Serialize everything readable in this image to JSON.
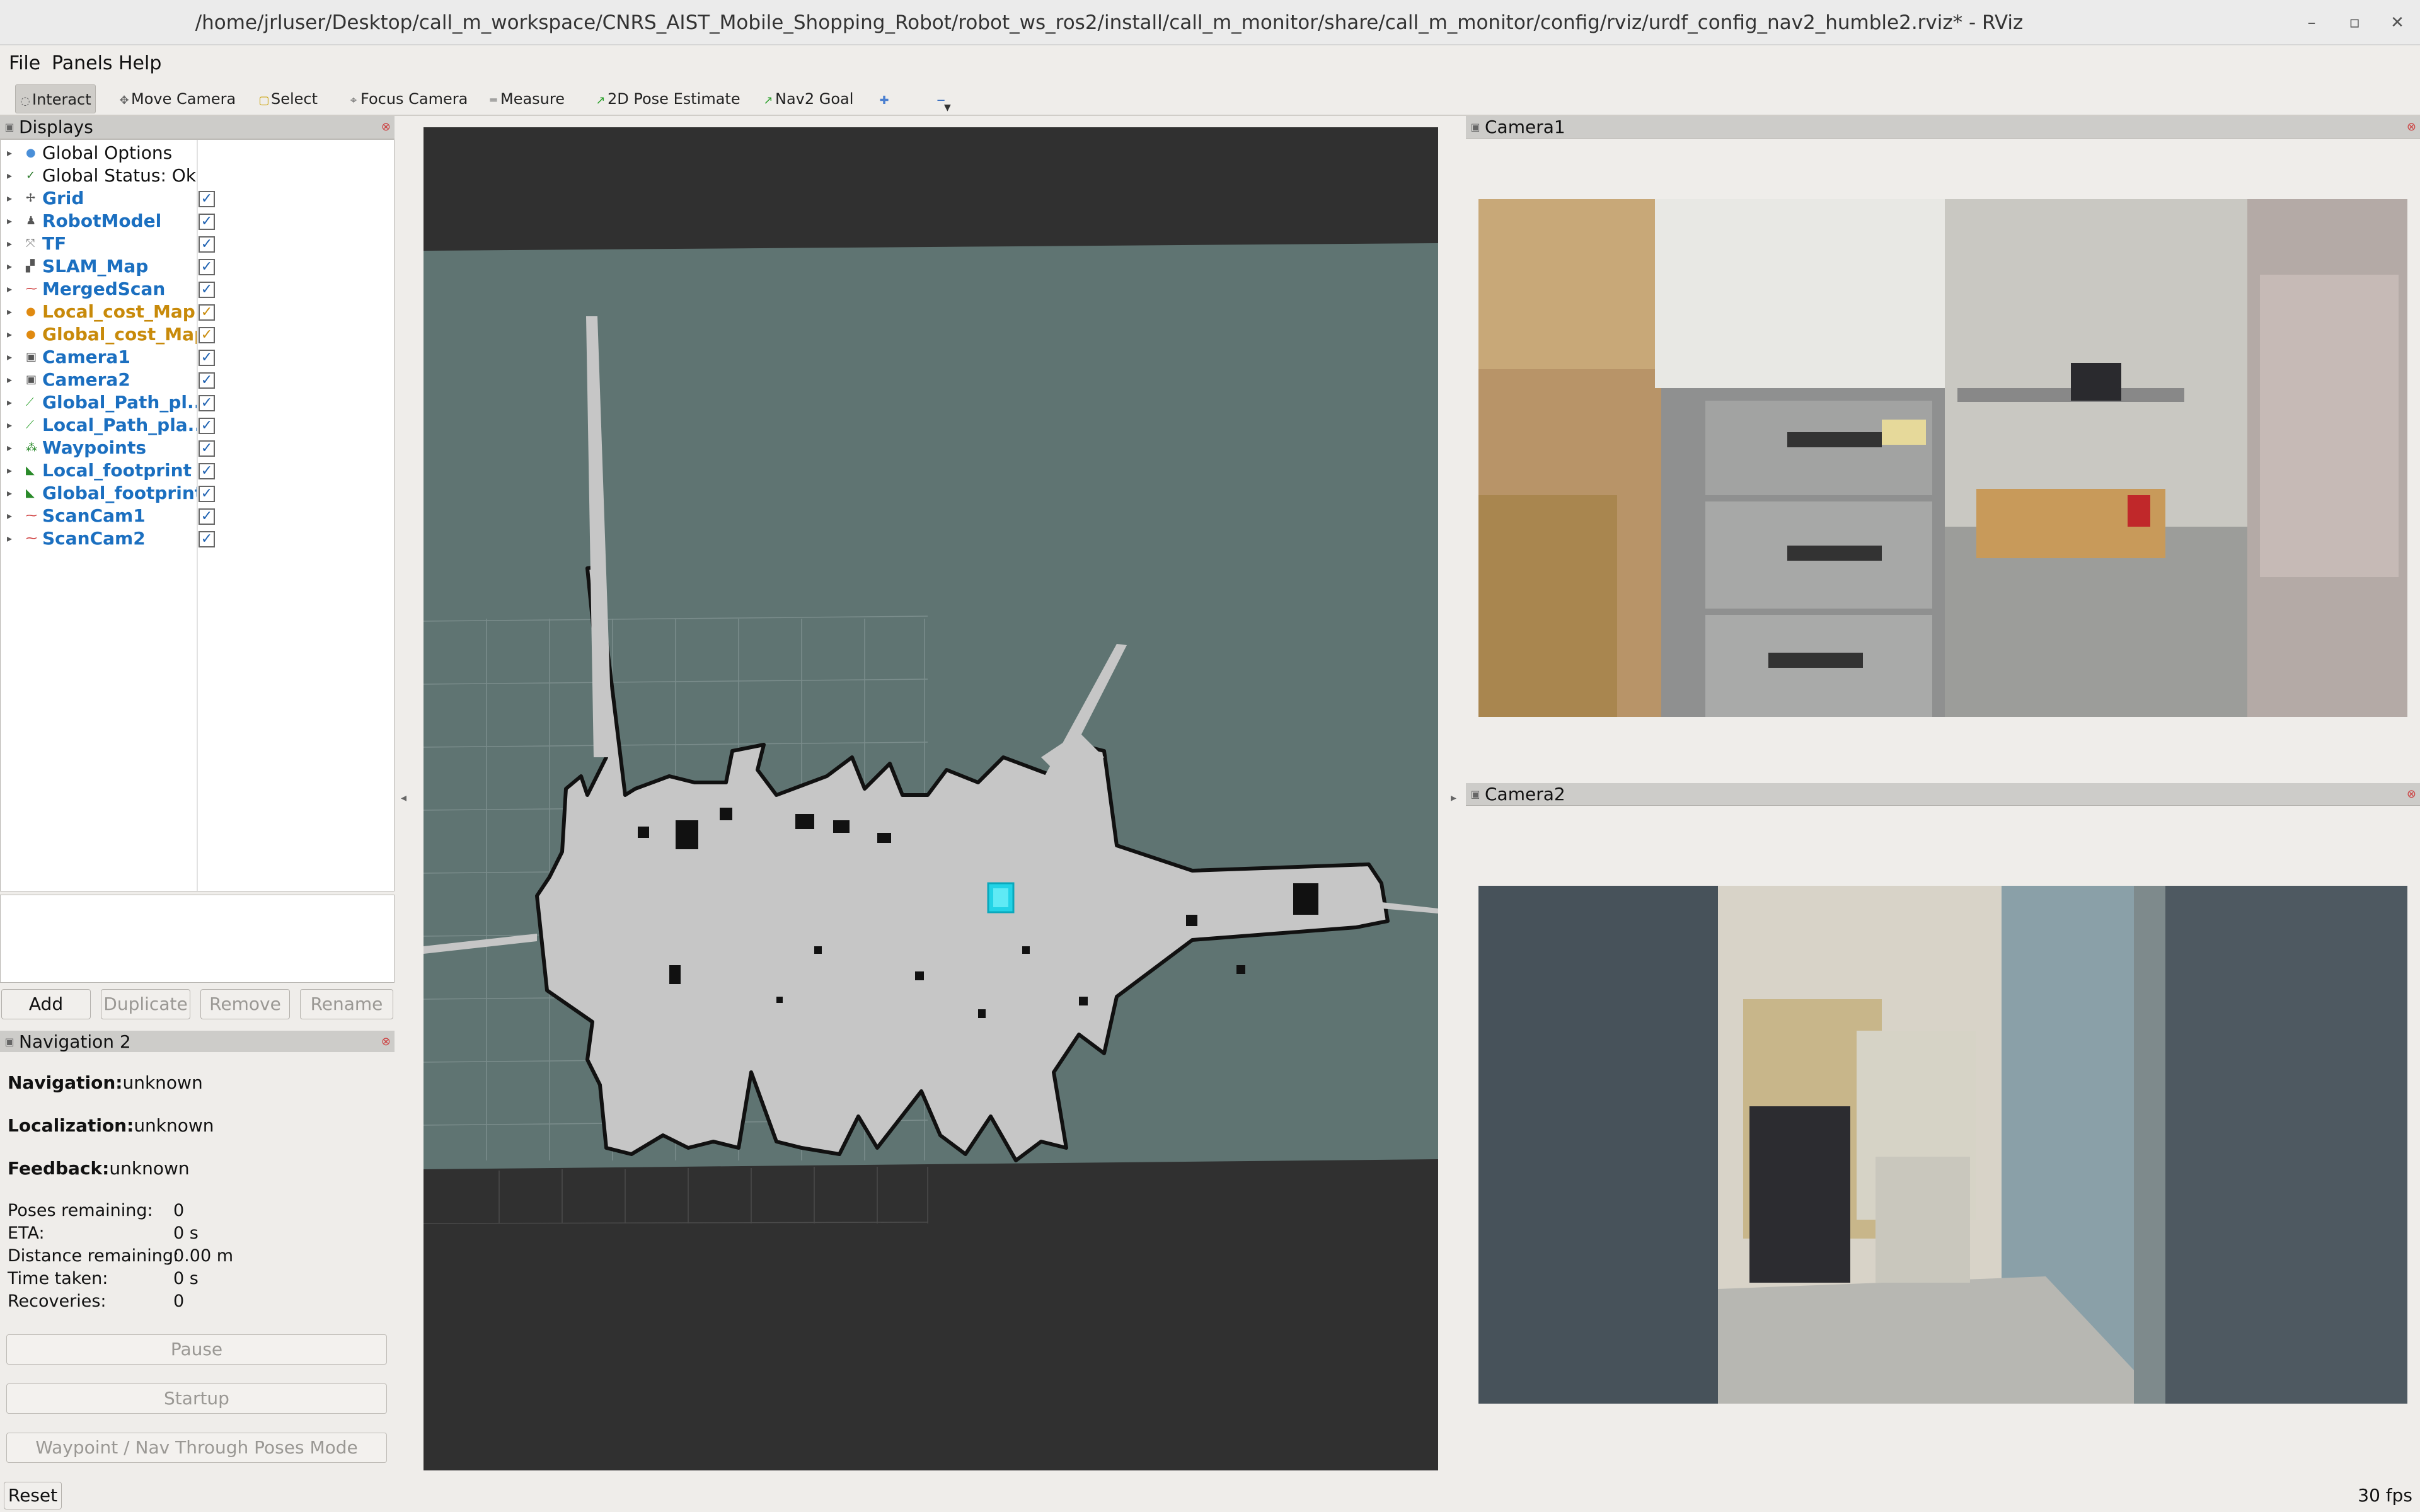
{
  "window": {
    "title": "/home/jrluser/Desktop/call_m_workspace/CNRS_AIST_Mobile_Shopping_Robot/robot_ws_ros2/install/call_m_monitor/share/call_m_monitor/config/rviz/urdf_config_nav2_humble2.rviz* - RViz",
    "controls": [
      "–",
      "▫",
      "✕"
    ]
  },
  "menu": [
    {
      "label": "File"
    },
    {
      "label": "Panels"
    },
    {
      "label": "Help"
    }
  ],
  "toolbar": [
    {
      "label": "Interact",
      "icon": "interact-icon",
      "glyph": "◌"
    },
    {
      "label": "Move Camera",
      "icon": "move-camera-icon",
      "glyph": "✥"
    },
    {
      "label": "Select",
      "icon": "select-icon",
      "glyph": "▢"
    },
    {
      "label": "Focus Camera",
      "icon": "focus-camera-icon",
      "glyph": "⌖"
    },
    {
      "label": "Measure",
      "icon": "measure-icon",
      "glyph": "═"
    },
    {
      "label": "2D Pose Estimate",
      "icon": "pose-estimate-icon",
      "glyph": "↗"
    },
    {
      "label": "Nav2 Goal",
      "icon": "nav2-goal-icon",
      "glyph": "↗"
    },
    {
      "label": "",
      "icon": "add-tool-icon",
      "glyph": "✚"
    },
    {
      "label": "",
      "icon": "remove-tool-icon",
      "glyph": "−"
    }
  ],
  "displays_panel": {
    "title": "Displays",
    "items": [
      {
        "label": "Global Options",
        "style": "plain",
        "icon": "global-options-icon",
        "glyph": "●",
        "icon_color": "#4a8fd8",
        "checked": null
      },
      {
        "label": "Global Status: Ok",
        "style": "plain",
        "icon": "status-ok-icon",
        "glyph": "✓",
        "icon_color": "#2a7a2a",
        "checked": null
      },
      {
        "label": "Grid",
        "style": "blue",
        "icon": "grid-icon",
        "glyph": "✢",
        "icon_color": "#555",
        "checked": "✓"
      },
      {
        "label": "RobotModel",
        "style": "blue",
        "icon": "robot-model-icon",
        "glyph": "♟",
        "icon_color": "#555",
        "checked": "✓"
      },
      {
        "label": "TF",
        "style": "blue",
        "icon": "tf-icon",
        "glyph": "⤧",
        "icon_color": "#777",
        "checked": "✓"
      },
      {
        "label": "SLAM_Map",
        "style": "blue",
        "icon": "map-icon",
        "glyph": "▞",
        "icon_color": "#555",
        "checked": "✓"
      },
      {
        "label": "MergedScan",
        "style": "blue",
        "icon": "laser-scan-icon",
        "glyph": "⁓",
        "icon_color": "#c33",
        "checked": "✓"
      },
      {
        "label": "Local_cost_Map",
        "style": "orange",
        "icon": "warning-dot-icon",
        "glyph": "●",
        "icon_color": "#e08a10",
        "checked": "✓"
      },
      {
        "label": "Global_cost_Map",
        "style": "orange",
        "icon": "warning-dot-icon",
        "glyph": "●",
        "icon_color": "#e08a10",
        "checked": "✓"
      },
      {
        "label": "Camera1",
        "style": "blue",
        "icon": "camera-icon",
        "glyph": "▣",
        "icon_color": "#555",
        "checked": "✓"
      },
      {
        "label": "Camera2",
        "style": "blue",
        "icon": "camera-icon",
        "glyph": "▣",
        "icon_color": "#555",
        "checked": "✓"
      },
      {
        "label": "Global_Path_pl...",
        "style": "blue",
        "icon": "path-icon",
        "glyph": "⟋",
        "icon_color": "#2aa02a",
        "checked": "✓"
      },
      {
        "label": "Local_Path_pla...",
        "style": "blue",
        "icon": "path-icon",
        "glyph": "⟋",
        "icon_color": "#2aa02a",
        "checked": "✓"
      },
      {
        "label": "Waypoints",
        "style": "blue",
        "icon": "marker-array-icon",
        "glyph": "⁂",
        "icon_color": "#2a8a2a",
        "checked": "✓"
      },
      {
        "label": "Local_footprint",
        "style": "blue",
        "icon": "polygon-icon",
        "glyph": "◣",
        "icon_color": "#2a8a2a",
        "checked": "✓"
      },
      {
        "label": "Global_footprint",
        "style": "blue",
        "icon": "polygon-icon",
        "glyph": "◣",
        "icon_color": "#2a8a2a",
        "checked": "✓"
      },
      {
        "label": "ScanCam1",
        "style": "blue",
        "icon": "laser-scan-icon",
        "glyph": "⁓",
        "icon_color": "#c33",
        "checked": "✓"
      },
      {
        "label": "ScanCam2",
        "style": "blue",
        "icon": "laser-scan-icon",
        "glyph": "⁓",
        "icon_color": "#c33",
        "checked": "✓"
      }
    ],
    "buttons": {
      "add": "Add",
      "duplicate": "Duplicate",
      "remove": "Remove",
      "rename": "Rename"
    }
  },
  "navigation_panel": {
    "title": "Navigation 2",
    "navigation_label": "Navigation:",
    "navigation_value": "unknown",
    "localization_label": "Localization:",
    "localization_value": "unknown",
    "feedback_label": "Feedback:",
    "feedback_value": "unknown",
    "stats": [
      {
        "label": "Poses remaining:",
        "value": "0"
      },
      {
        "label": "ETA:",
        "value": "0 s"
      },
      {
        "label": "Distance remaining:",
        "value": "0.00 m"
      },
      {
        "label": "Time taken:",
        "value": "0 s"
      },
      {
        "label": "Recoveries:",
        "value": "0"
      }
    ],
    "pause_label": "Pause",
    "startup_label": "Startup",
    "mode_label": "Waypoint / Nav Through Poses Mode"
  },
  "camera1_panel": {
    "title": "Camera1"
  },
  "camera2_panel": {
    "title": "Camera2"
  },
  "footer": {
    "reset_label": "Reset",
    "fps": "30 fps"
  },
  "colors": {
    "map_unknown": "#5f7472",
    "map_free": "#c6c6c6",
    "map_occupied": "#111111",
    "robot": "#22d3e6",
    "background": "#303030"
  }
}
